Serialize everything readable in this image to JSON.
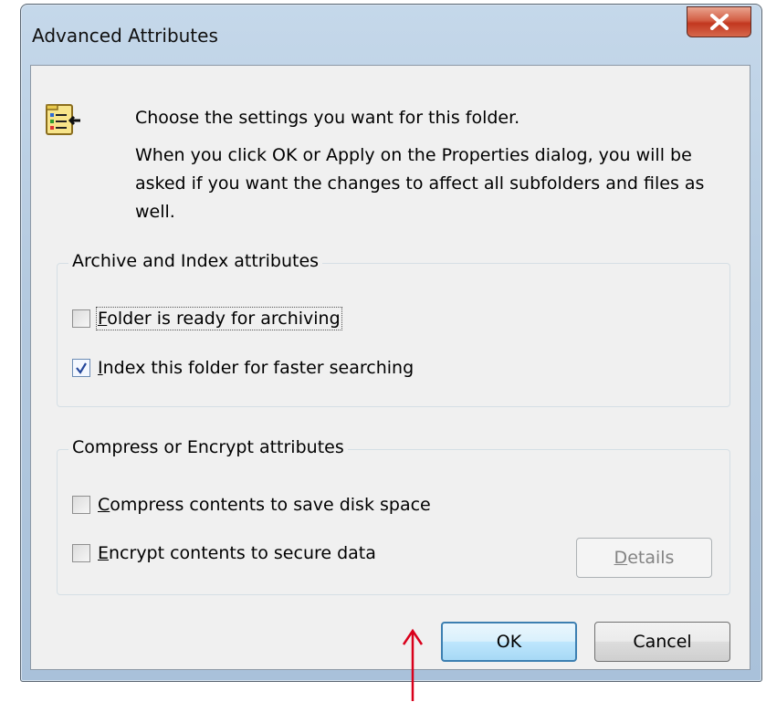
{
  "window": {
    "title": "Advanced Attributes",
    "close_label": "X"
  },
  "intro": {
    "line1": "Choose the settings you want for this folder.",
    "line2": "When you click OK or Apply on the Properties dialog, you will be asked if you want the changes to affect all subfolders and files as well."
  },
  "archive_group": {
    "legend": "Archive and Index attributes",
    "archive_checkbox": {
      "hotkey": "F",
      "label_rest": "older is ready for archiving",
      "checked": false
    },
    "index_checkbox": {
      "hotkey": "I",
      "label_rest": "ndex this folder for faster searching",
      "checked": true
    }
  },
  "compress_group": {
    "legend": "Compress or Encrypt attributes",
    "compress_checkbox": {
      "hotkey": "C",
      "label_rest": "ompress contents to save disk space",
      "checked": false
    },
    "encrypt_checkbox": {
      "hotkey": "E",
      "label_rest": "ncrypt contents to secure data",
      "checked": false
    },
    "details_button": {
      "hotkey": "D",
      "label_rest": "etails",
      "enabled": false
    }
  },
  "buttons": {
    "ok": "OK",
    "cancel": "Cancel"
  },
  "colors": {
    "annotation_arrow": "#d9001b",
    "default_button_border": "#3c7fb1"
  }
}
